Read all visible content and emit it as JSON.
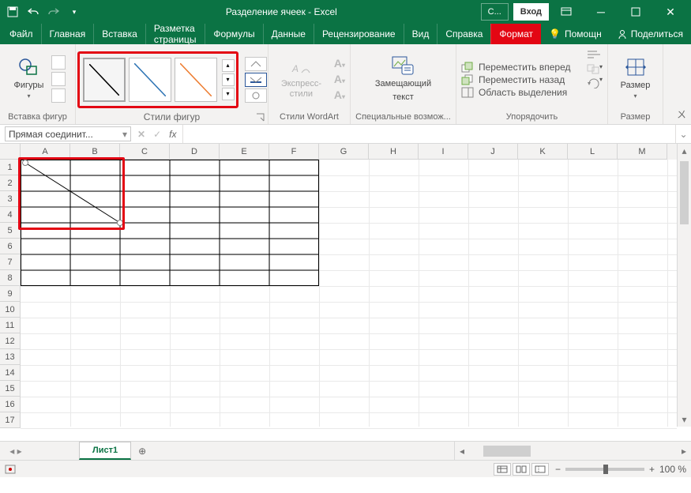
{
  "titlebar": {
    "doc_title": "Разделение ячеек",
    "app_name": "Excel",
    "full_title": "Разделение ячеек  -  Excel",
    "context_tab_short": "С...",
    "login": "Вход"
  },
  "tabs": {
    "items": [
      "Файл",
      "Главная",
      "Вставка",
      "Разметка страницы",
      "Формулы",
      "Данные",
      "Рецензирование",
      "Вид",
      "Справка",
      "Формат"
    ],
    "active_index": 9,
    "tell_me": "Помощн",
    "share": "Поделиться"
  },
  "ribbon": {
    "groups": {
      "insert_shapes": {
        "label": "Вставка фигур",
        "shapes_btn": "Фигуры"
      },
      "shape_styles": {
        "label": "Стили фигур"
      },
      "wordart": {
        "label": "Стили WordArt",
        "btn": "Экспресс-стили"
      },
      "accessibility": {
        "label": "Специальные возмож...",
        "btn_line1": "Замещающий",
        "btn_line2": "текст"
      },
      "arrange": {
        "label": "Упорядочить",
        "bring_forward": "Переместить вперед",
        "send_backward": "Переместить назад",
        "selection_pane": "Область выделения"
      },
      "size": {
        "label": "Размер",
        "btn": "Размер"
      }
    }
  },
  "namebox": {
    "value": "Прямая соединит..."
  },
  "grid": {
    "columns": [
      "A",
      "B",
      "C",
      "D",
      "E",
      "F",
      "G",
      "H",
      "I",
      "J",
      "K",
      "L",
      "M"
    ],
    "rows": [
      "1",
      "2",
      "3",
      "4",
      "5",
      "6",
      "7",
      "8",
      "9",
      "10",
      "11",
      "12",
      "13",
      "14",
      "15",
      "16",
      "17"
    ],
    "bordered_range": {
      "cols": 6,
      "rows": 8
    },
    "highlight_range": {
      "c0": 0,
      "c1": 2,
      "r0": 0,
      "r1": 4
    }
  },
  "sheets": {
    "active": "Лист1"
  },
  "status": {
    "zoom_pct": "100 %"
  }
}
